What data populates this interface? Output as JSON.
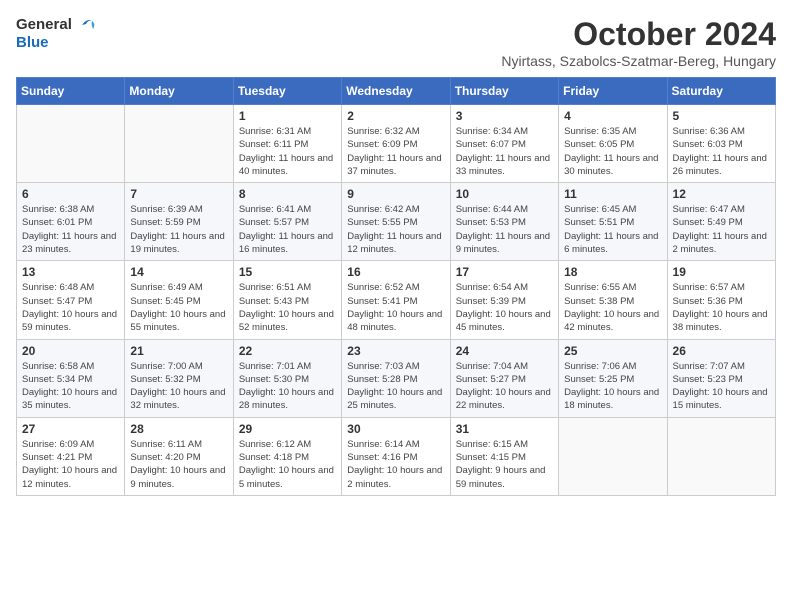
{
  "logo": {
    "general": "General",
    "blue": "Blue"
  },
  "title": {
    "month": "October 2024",
    "location": "Nyirtass, Szabolcs-Szatmar-Bereg, Hungary"
  },
  "headers": [
    "Sunday",
    "Monday",
    "Tuesday",
    "Wednesday",
    "Thursday",
    "Friday",
    "Saturday"
  ],
  "weeks": [
    [
      {
        "day": "",
        "info": ""
      },
      {
        "day": "",
        "info": ""
      },
      {
        "day": "1",
        "info": "Sunrise: 6:31 AM\nSunset: 6:11 PM\nDaylight: 11 hours and 40 minutes."
      },
      {
        "day": "2",
        "info": "Sunrise: 6:32 AM\nSunset: 6:09 PM\nDaylight: 11 hours and 37 minutes."
      },
      {
        "day": "3",
        "info": "Sunrise: 6:34 AM\nSunset: 6:07 PM\nDaylight: 11 hours and 33 minutes."
      },
      {
        "day": "4",
        "info": "Sunrise: 6:35 AM\nSunset: 6:05 PM\nDaylight: 11 hours and 30 minutes."
      },
      {
        "day": "5",
        "info": "Sunrise: 6:36 AM\nSunset: 6:03 PM\nDaylight: 11 hours and 26 minutes."
      }
    ],
    [
      {
        "day": "6",
        "info": "Sunrise: 6:38 AM\nSunset: 6:01 PM\nDaylight: 11 hours and 23 minutes."
      },
      {
        "day": "7",
        "info": "Sunrise: 6:39 AM\nSunset: 5:59 PM\nDaylight: 11 hours and 19 minutes."
      },
      {
        "day": "8",
        "info": "Sunrise: 6:41 AM\nSunset: 5:57 PM\nDaylight: 11 hours and 16 minutes."
      },
      {
        "day": "9",
        "info": "Sunrise: 6:42 AM\nSunset: 5:55 PM\nDaylight: 11 hours and 12 minutes."
      },
      {
        "day": "10",
        "info": "Sunrise: 6:44 AM\nSunset: 5:53 PM\nDaylight: 11 hours and 9 minutes."
      },
      {
        "day": "11",
        "info": "Sunrise: 6:45 AM\nSunset: 5:51 PM\nDaylight: 11 hours and 6 minutes."
      },
      {
        "day": "12",
        "info": "Sunrise: 6:47 AM\nSunset: 5:49 PM\nDaylight: 11 hours and 2 minutes."
      }
    ],
    [
      {
        "day": "13",
        "info": "Sunrise: 6:48 AM\nSunset: 5:47 PM\nDaylight: 10 hours and 59 minutes."
      },
      {
        "day": "14",
        "info": "Sunrise: 6:49 AM\nSunset: 5:45 PM\nDaylight: 10 hours and 55 minutes."
      },
      {
        "day": "15",
        "info": "Sunrise: 6:51 AM\nSunset: 5:43 PM\nDaylight: 10 hours and 52 minutes."
      },
      {
        "day": "16",
        "info": "Sunrise: 6:52 AM\nSunset: 5:41 PM\nDaylight: 10 hours and 48 minutes."
      },
      {
        "day": "17",
        "info": "Sunrise: 6:54 AM\nSunset: 5:39 PM\nDaylight: 10 hours and 45 minutes."
      },
      {
        "day": "18",
        "info": "Sunrise: 6:55 AM\nSunset: 5:38 PM\nDaylight: 10 hours and 42 minutes."
      },
      {
        "day": "19",
        "info": "Sunrise: 6:57 AM\nSunset: 5:36 PM\nDaylight: 10 hours and 38 minutes."
      }
    ],
    [
      {
        "day": "20",
        "info": "Sunrise: 6:58 AM\nSunset: 5:34 PM\nDaylight: 10 hours and 35 minutes."
      },
      {
        "day": "21",
        "info": "Sunrise: 7:00 AM\nSunset: 5:32 PM\nDaylight: 10 hours and 32 minutes."
      },
      {
        "day": "22",
        "info": "Sunrise: 7:01 AM\nSunset: 5:30 PM\nDaylight: 10 hours and 28 minutes."
      },
      {
        "day": "23",
        "info": "Sunrise: 7:03 AM\nSunset: 5:28 PM\nDaylight: 10 hours and 25 minutes."
      },
      {
        "day": "24",
        "info": "Sunrise: 7:04 AM\nSunset: 5:27 PM\nDaylight: 10 hours and 22 minutes."
      },
      {
        "day": "25",
        "info": "Sunrise: 7:06 AM\nSunset: 5:25 PM\nDaylight: 10 hours and 18 minutes."
      },
      {
        "day": "26",
        "info": "Sunrise: 7:07 AM\nSunset: 5:23 PM\nDaylight: 10 hours and 15 minutes."
      }
    ],
    [
      {
        "day": "27",
        "info": "Sunrise: 6:09 AM\nSunset: 4:21 PM\nDaylight: 10 hours and 12 minutes."
      },
      {
        "day": "28",
        "info": "Sunrise: 6:11 AM\nSunset: 4:20 PM\nDaylight: 10 hours and 9 minutes."
      },
      {
        "day": "29",
        "info": "Sunrise: 6:12 AM\nSunset: 4:18 PM\nDaylight: 10 hours and 5 minutes."
      },
      {
        "day": "30",
        "info": "Sunrise: 6:14 AM\nSunset: 4:16 PM\nDaylight: 10 hours and 2 minutes."
      },
      {
        "day": "31",
        "info": "Sunrise: 6:15 AM\nSunset: 4:15 PM\nDaylight: 9 hours and 59 minutes."
      },
      {
        "day": "",
        "info": ""
      },
      {
        "day": "",
        "info": ""
      }
    ]
  ]
}
